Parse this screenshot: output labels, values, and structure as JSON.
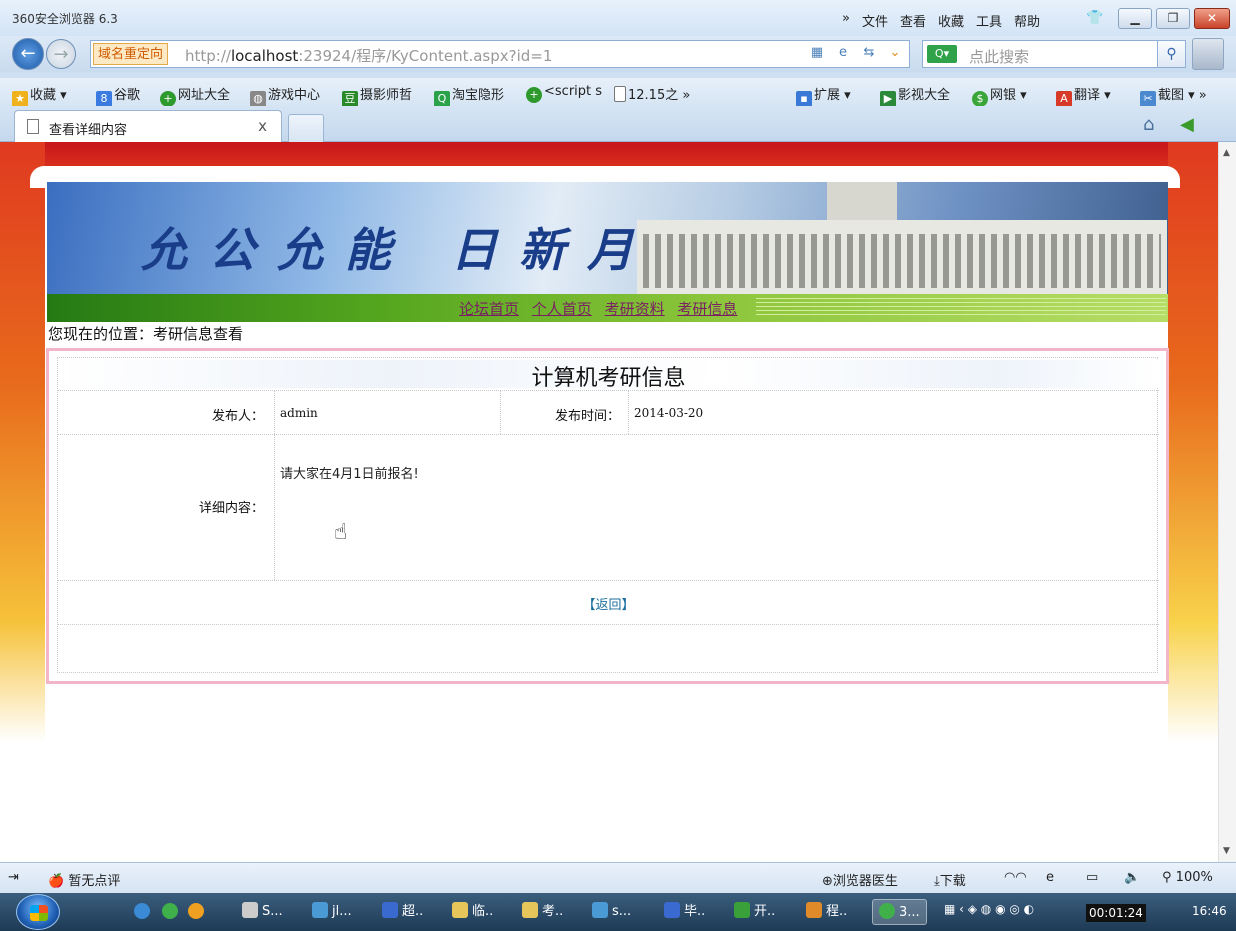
{
  "window": {
    "title": "360安全浏览器 6.3",
    "menus": [
      "»",
      "文件",
      "查看",
      "收藏",
      "工具",
      "帮助"
    ]
  },
  "address": {
    "redirect_tag": "域名重定向",
    "url_prefix": "http://",
    "url_host": "localhost",
    "url_rest": ":23924/程序/KyContent.aspx?id=1"
  },
  "search": {
    "placeholder": "点此搜索"
  },
  "bookmarks": [
    {
      "label": "收藏 ▾",
      "icon": "star-icon"
    },
    {
      "label": "谷歌",
      "icon": "google-icon"
    },
    {
      "label": "网址大全",
      "icon": "plus-circle-icon"
    },
    {
      "label": "游戏中心",
      "icon": "gamepad-icon"
    },
    {
      "label": "摄影师哲",
      "icon": "douban-icon"
    },
    {
      "label": "淘宝隐形",
      "icon": "search-icon"
    },
    {
      "label": "<script s",
      "icon": "plus-circle-icon"
    },
    {
      "label": "12.15之 »",
      "icon": "doc-icon"
    },
    {
      "label": "扩展 ▾",
      "icon": "grid-icon"
    },
    {
      "label": "影视大全",
      "icon": "play-icon"
    },
    {
      "label": "网银 ▾",
      "icon": "bank-icon"
    },
    {
      "label": "翻译 ▾",
      "icon": "translate-icon"
    },
    {
      "label": "截图 ▾ »",
      "icon": "screenshot-icon"
    }
  ],
  "tab": {
    "label": "查看详细内容",
    "close": "x"
  },
  "page": {
    "slogan": "允公允能 日新月异",
    "nav_links": [
      "论坛首页",
      "个人首页",
      "考研资料",
      "考研信息"
    ],
    "breadcrumb": "您现在的位置：考研信息查看",
    "detail_title": "计算机考研信息",
    "publisher_label": "发布人：",
    "publisher_value": "admin",
    "time_label": "发布时间：",
    "time_value": "2014-03-20",
    "content_label": "详细内容：",
    "content_value": "请大家在4月1日前报名!",
    "return_link": "【返回】"
  },
  "statusbar": {
    "comment": "暂无点评",
    "doctor": "浏览器医生",
    "download": "下载",
    "zoom": "100%"
  },
  "taskbar": {
    "tasks": [
      "S...",
      "jl...",
      "超..",
      "临..",
      "考..",
      "s...",
      "毕..",
      "开..",
      "程..",
      "3..."
    ],
    "timer": "00:01:24",
    "clock": "16:46"
  },
  "colors": {
    "nav_link": "#7a1f63",
    "panel_border": "#f2b6c8",
    "return_link": "#1b6e9e"
  }
}
